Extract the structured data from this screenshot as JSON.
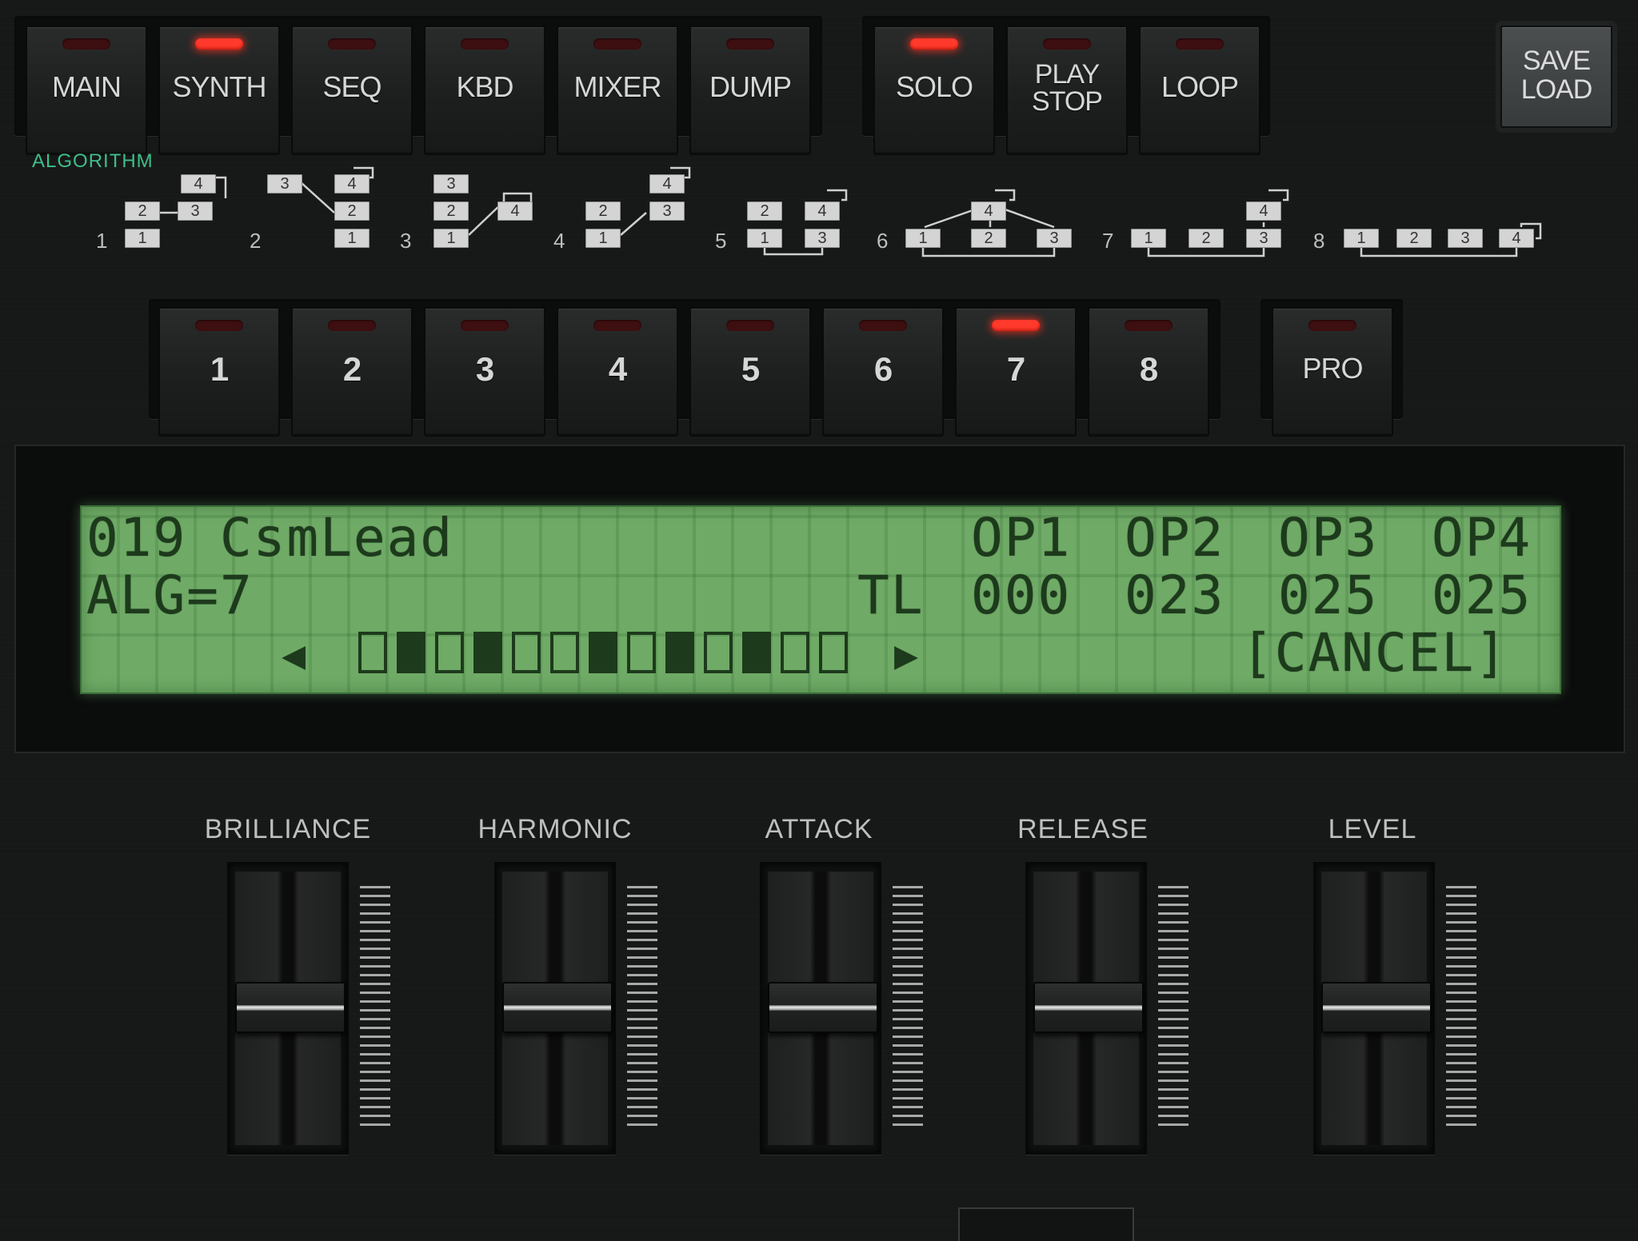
{
  "top_nav": {
    "tabs": [
      {
        "label": "MAIN",
        "active": false
      },
      {
        "label": "SYNTH",
        "active": true
      },
      {
        "label": "SEQ",
        "active": false
      },
      {
        "label": "KBD",
        "active": false
      },
      {
        "label": "MIXER",
        "active": false
      },
      {
        "label": "DUMP",
        "active": false
      }
    ],
    "transport": [
      {
        "label": "SOLO",
        "active": true
      },
      {
        "label": "PLAY\nSTOP",
        "line1": "PLAY",
        "line2": "STOP",
        "active": false
      },
      {
        "label": "LOOP",
        "active": false
      }
    ],
    "save": {
      "line1": "SAVE",
      "line2": "LOAD"
    }
  },
  "algorithm": {
    "title": "ALGORITHM",
    "numbers": [
      "1",
      "2",
      "3",
      "4",
      "5",
      "6",
      "7",
      "8"
    ],
    "op_labels": [
      "1",
      "2",
      "3",
      "4"
    ]
  },
  "alg_selector": {
    "buttons": [
      {
        "label": "1",
        "active": false
      },
      {
        "label": "2",
        "active": false
      },
      {
        "label": "3",
        "active": false
      },
      {
        "label": "4",
        "active": false
      },
      {
        "label": "5",
        "active": false
      },
      {
        "label": "6",
        "active": false
      },
      {
        "label": "7",
        "active": true
      },
      {
        "label": "8",
        "active": false
      }
    ],
    "pro": {
      "label": "PRO",
      "active": false
    }
  },
  "lcd": {
    "patch": "019 CsmLead",
    "op_headers": [
      "OP1",
      "OP2",
      "OP3",
      "OP4"
    ],
    "alg": "ALG=7",
    "tl_label": "TL",
    "tl_values": [
      "000",
      "023",
      "025",
      "025"
    ],
    "cancel": "[CANCEL]",
    "arrow_left": "◀",
    "arrow_right": "▶"
  },
  "faders": [
    {
      "label": "BRILLIANCE",
      "value": 0.5
    },
    {
      "label": "HARMONIC",
      "value": 0.5
    },
    {
      "label": "ATTACK",
      "value": 0.5
    },
    {
      "label": "RELEASE",
      "value": 0.5
    },
    {
      "label": "LEVEL",
      "value": 0.5
    }
  ],
  "colors": {
    "led_on": "#ff3a2c",
    "lcd_bg": "#6faa66",
    "lcd_text": "#1d3a1c",
    "algorithm_title": "#3fbf88"
  }
}
